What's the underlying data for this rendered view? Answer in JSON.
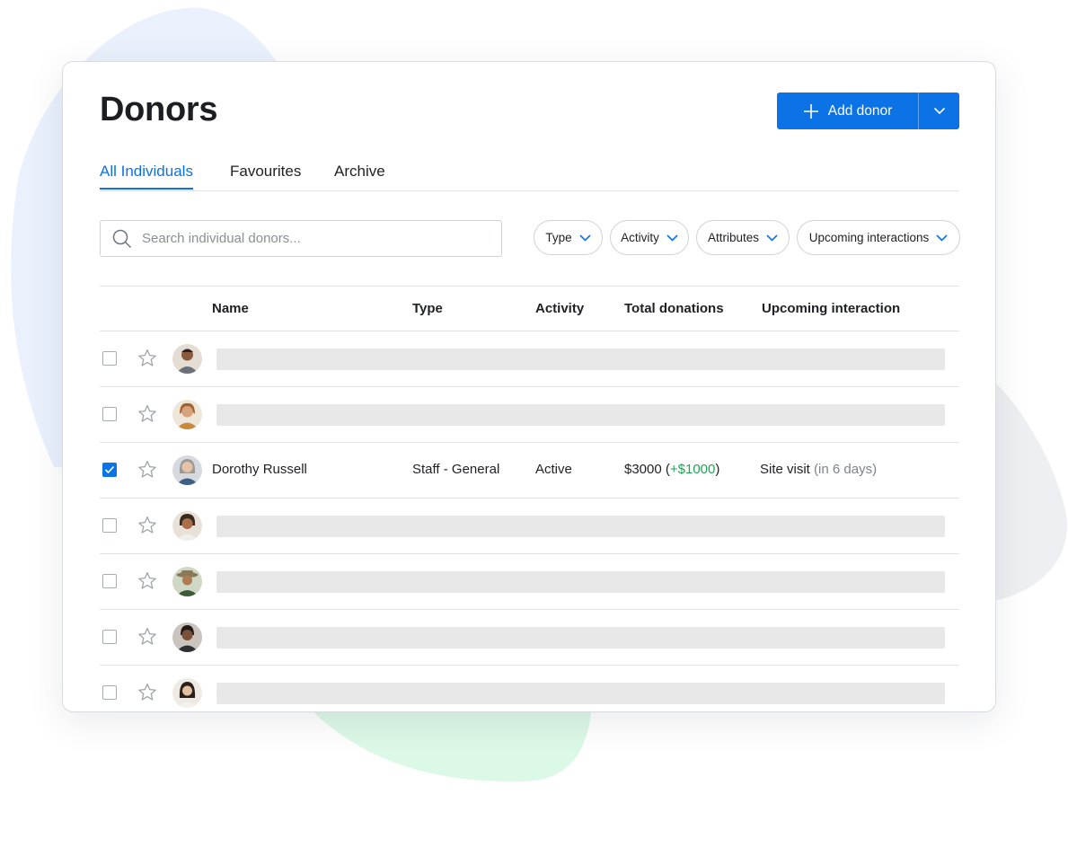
{
  "page": {
    "title": "Donors"
  },
  "header": {
    "add_label": "Add donor"
  },
  "tabs": [
    {
      "label": "All Individuals",
      "active": true
    },
    {
      "label": "Favourites",
      "active": false
    },
    {
      "label": "Archive",
      "active": false
    }
  ],
  "search": {
    "placeholder": "Search individual donors...",
    "value": ""
  },
  "filters": [
    {
      "label": "Type"
    },
    {
      "label": "Activity"
    },
    {
      "label": "Attributes"
    },
    {
      "label": "Upcoming interactions"
    }
  ],
  "table": {
    "columns": [
      "Name",
      "Type",
      "Activity",
      "Total donations",
      "Upcoming interaction"
    ],
    "rows": [
      {
        "checked": false,
        "loading": true
      },
      {
        "checked": false,
        "loading": true
      },
      {
        "checked": true,
        "loading": false,
        "name": "Dorothy Russell",
        "type": "Staff - General",
        "activity": "Active",
        "total": "$3000",
        "total_open": " (",
        "total_change": "+$1000",
        "total_close": ")",
        "interaction": "Site visit",
        "interaction_when": "(in 6 days)"
      },
      {
        "checked": false,
        "loading": true
      },
      {
        "checked": false,
        "loading": true
      },
      {
        "checked": false,
        "loading": true
      },
      {
        "checked": false,
        "loading": true
      }
    ]
  },
  "colors": {
    "accent": "#0b73e6",
    "positive": "#22a357",
    "muted_text": "#80838a",
    "skeleton": "#e8e8e8"
  },
  "icons": {
    "search": "search-icon",
    "add": "plus-icon",
    "dropdown": "chevron-down-icon",
    "favourite": "star-icon",
    "checkbox": "checkbox-icon",
    "avatar": "avatar"
  }
}
